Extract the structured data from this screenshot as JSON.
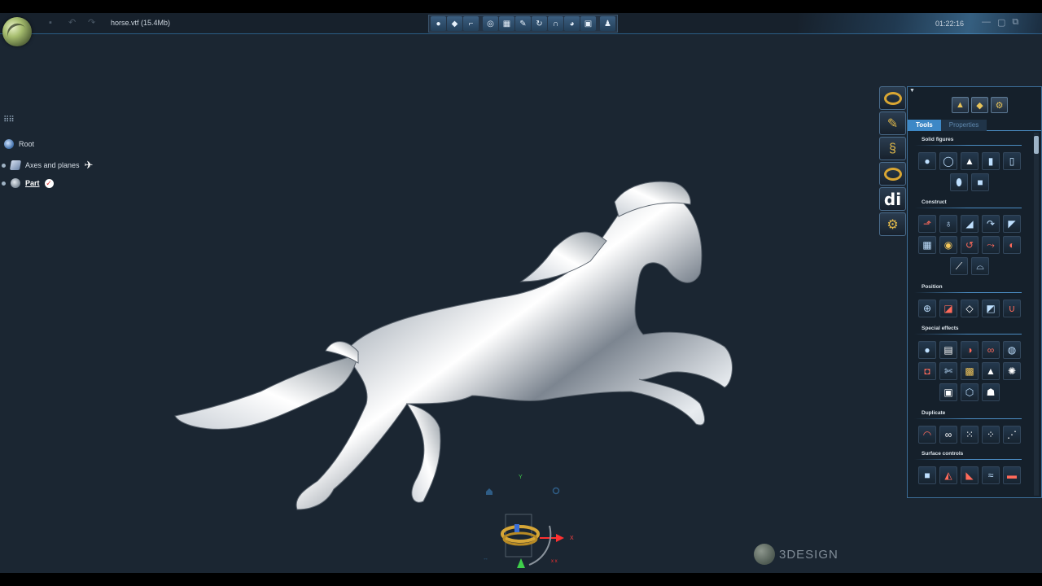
{
  "window": {
    "doc_title": "horse.vtf (15.4Mb)",
    "clock": "01:22:16",
    "quick_icons": [
      "save-icon",
      "undo-icon",
      "redo-icon"
    ],
    "window_controls": [
      "minimize-icon",
      "restore-icon",
      "close-icon"
    ]
  },
  "top_toolbar": [
    {
      "icon": "sphere-icon",
      "glyph": "●"
    },
    {
      "icon": "gem-icon",
      "glyph": "◆"
    },
    {
      "icon": "shoe-icon",
      "glyph": "⌐"
    },
    {
      "icon": "ring-gem-icon",
      "glyph": "◎"
    },
    {
      "icon": "grid-icon",
      "glyph": "▦"
    },
    {
      "icon": "brush-icon",
      "glyph": "✎"
    },
    {
      "icon": "rotate-icon",
      "glyph": "↻"
    },
    {
      "icon": "magnet-icon",
      "glyph": "∩"
    },
    {
      "icon": "pie-icon",
      "glyph": "◕"
    },
    {
      "icon": "display-icon",
      "glyph": "▣"
    },
    {
      "icon": "person-icon",
      "glyph": "♟"
    }
  ],
  "tree": {
    "root_label": "Root",
    "axes_label": "Axes and planes",
    "part_label": "Part"
  },
  "gizmo": {
    "y_label": "Y",
    "x_label": "X"
  },
  "brand": {
    "text": "3DESIGN"
  },
  "mode_bar": [
    {
      "name": "ring-mode-icon",
      "kind": "ring"
    },
    {
      "name": "construct-mode-icon",
      "kind": "glyph",
      "glyph": "✎"
    },
    {
      "name": "snake-mode-icon",
      "kind": "glyph",
      "glyph": "§"
    },
    {
      "name": "ring-render-icon",
      "kind": "ring"
    },
    {
      "name": "di-mode-icon",
      "kind": "di",
      "glyph": "di"
    },
    {
      "name": "gears-mode-icon",
      "kind": "glyph",
      "glyph": "⚙"
    }
  ],
  "panel": {
    "tabs": {
      "tools": "Tools",
      "properties": "Properties"
    },
    "head_icons": [
      "shapes-icon",
      "pieces-icon",
      "settings-gear-icon"
    ],
    "sections": [
      {
        "title": "Solid figures",
        "tools": [
          {
            "name": "sphere-tool-icon",
            "glyph": "●",
            "tone": "blue"
          },
          {
            "name": "torus-tool-icon",
            "glyph": "◯",
            "tone": "blue"
          },
          {
            "name": "cone-tool-icon",
            "glyph": "▲",
            "tone": "white"
          },
          {
            "name": "cylinder-tool-icon",
            "glyph": "▮",
            "tone": "blue"
          },
          {
            "name": "tube-tool-icon",
            "glyph": "▯",
            "tone": "blue"
          },
          {
            "name": "capsule-tool-icon",
            "glyph": "⬮",
            "tone": "blue"
          },
          {
            "name": "cube-tool-icon",
            "glyph": "■",
            "tone": "blue"
          }
        ]
      },
      {
        "title": "Construct",
        "tools": [
          {
            "name": "extrude-tool-icon",
            "glyph": "⬏",
            "tone": "red"
          },
          {
            "name": "revolve-tool-icon",
            "glyph": "♁",
            "tone": "blue"
          },
          {
            "name": "sweep-tool-icon",
            "glyph": "◢",
            "tone": "blue"
          },
          {
            "name": "pipe-tool-icon",
            "glyph": "↷",
            "tone": "blue"
          },
          {
            "name": "loft-tool-icon",
            "glyph": "◤",
            "tone": "blue"
          },
          {
            "name": "mesh-tool-icon",
            "glyph": "▦",
            "tone": "blue"
          },
          {
            "name": "gem-shape-tool-icon",
            "glyph": "◉",
            "tone": "warm"
          },
          {
            "name": "helix-tool-icon",
            "glyph": "↺",
            "tone": "red"
          },
          {
            "name": "skin-tool-icon",
            "glyph": "⤳",
            "tone": "red"
          },
          {
            "name": "shell-tool-icon",
            "glyph": "◐",
            "tone": "red"
          },
          {
            "name": "cut-tool-icon",
            "glyph": "⟋",
            "tone": "white"
          },
          {
            "name": "blend-tool-icon",
            "glyph": "⌓",
            "tone": "blue"
          }
        ]
      },
      {
        "title": "Position",
        "tools": [
          {
            "name": "move-tool-icon",
            "glyph": "⊕",
            "tone": "blue"
          },
          {
            "name": "align-tool-icon",
            "glyph": "◪",
            "tone": "red"
          },
          {
            "name": "place-gem-tool-icon",
            "glyph": "◇",
            "tone": "white"
          },
          {
            "name": "project-tool-icon",
            "glyph": "◩",
            "tone": "blue"
          },
          {
            "name": "magnet-tool-icon",
            "glyph": "∪",
            "tone": "red"
          }
        ]
      },
      {
        "title": "Special effects",
        "tools": [
          {
            "name": "bubble-tool-icon",
            "glyph": "●",
            "tone": "blue"
          },
          {
            "name": "texture-tool-icon",
            "glyph": "▤",
            "tone": "white"
          },
          {
            "name": "cutout-tool-icon",
            "glyph": "◑",
            "tone": "red"
          },
          {
            "name": "twist-tool-icon",
            "glyph": "∞",
            "tone": "red"
          },
          {
            "name": "pattern-ball-tool-icon",
            "glyph": "◍",
            "tone": "blue"
          },
          {
            "name": "engrave-tool-icon",
            "glyph": "◘",
            "tone": "red"
          },
          {
            "name": "deform-tool-icon",
            "glyph": "✄",
            "tone": "blue"
          },
          {
            "name": "pave-tool-icon",
            "glyph": "▩",
            "tone": "warm"
          },
          {
            "name": "relief-tool-icon",
            "glyph": "▲",
            "tone": "white"
          },
          {
            "name": "star-tool-icon",
            "glyph": "✺",
            "tone": "white"
          },
          {
            "name": "frame-tool-icon",
            "glyph": "▣",
            "tone": "white"
          },
          {
            "name": "crystal-tool-icon",
            "glyph": "⬡",
            "tone": "blue"
          },
          {
            "name": "prong-tool-icon",
            "glyph": "☗",
            "tone": "white"
          }
        ]
      },
      {
        "title": "Duplicate",
        "tools": [
          {
            "name": "mirror-tool-icon",
            "glyph": "◠",
            "tone": "red"
          },
          {
            "name": "link-tool-icon",
            "glyph": "∞",
            "tone": "white"
          },
          {
            "name": "array-tool-icon",
            "glyph": "⁙",
            "tone": "white"
          },
          {
            "name": "circular-array-tool-icon",
            "glyph": "⁘",
            "tone": "white"
          },
          {
            "name": "along-curve-tool-icon",
            "glyph": "⋰",
            "tone": "white"
          }
        ]
      },
      {
        "title": "Surface controls",
        "tools": [
          {
            "name": "surface-box-tool-icon",
            "glyph": "■",
            "tone": "blue"
          },
          {
            "name": "surface-edit-tool-icon",
            "glyph": "◭",
            "tone": "red"
          },
          {
            "name": "surface-bend-tool-icon",
            "glyph": "◣",
            "tone": "red"
          },
          {
            "name": "surface-wave-tool-icon",
            "glyph": "≈",
            "tone": "blue"
          },
          {
            "name": "surface-flat-tool-icon",
            "glyph": "▬",
            "tone": "red"
          }
        ]
      }
    ]
  }
}
